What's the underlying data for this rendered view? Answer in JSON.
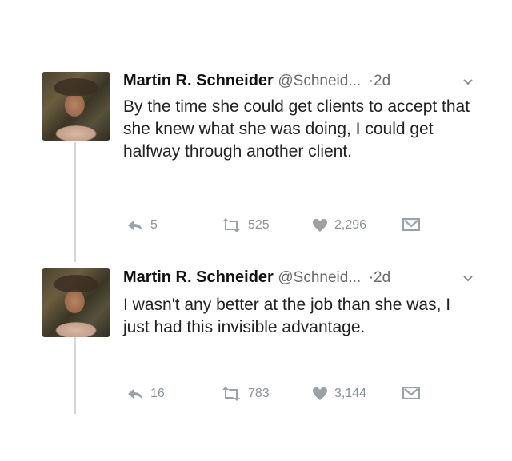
{
  "tweets": [
    {
      "name": "Martin R. Schneider",
      "handle": "@Schneid...",
      "time": "·2d",
      "text": "By the time she could get clients to accept that she knew what she was doing, I could get halfway through another client.",
      "reply_count": "5",
      "retweet_count": "525",
      "like_count": "2,296"
    },
    {
      "name": "Martin R. Schneider",
      "handle": "@Schneid...",
      "time": "·2d",
      "text": "I wasn't any better at the job than she was, I just had this invisible advantage.",
      "reply_count": "16",
      "retweet_count": "783",
      "like_count": "3,144"
    }
  ],
  "colors": {
    "thread_line": "#cfd6dc",
    "icon_gray": "#8a9299"
  },
  "icons": [
    "reply-icon",
    "retweet-icon",
    "like-icon",
    "direct-message-icon",
    "chevron-down-icon"
  ]
}
